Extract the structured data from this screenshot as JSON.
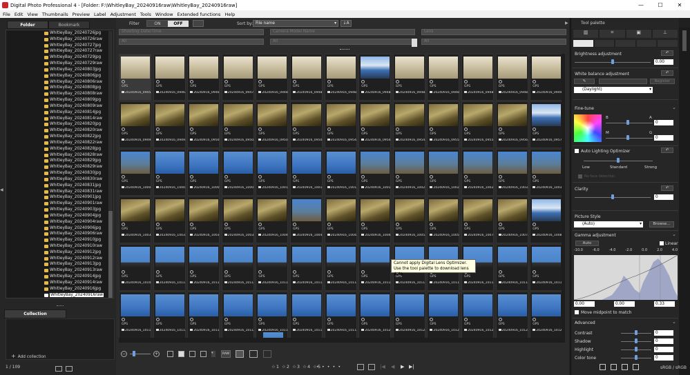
{
  "window": {
    "title": "Digital Photo Professional 4 - [Folder: F:\\WhitleyBay_20240916raw\\WhitleyBay_20240916raw]",
    "controls": [
      "—",
      "☐",
      "✕"
    ]
  },
  "menu": [
    "File",
    "Edit",
    "View",
    "Thumbnails",
    "Preview",
    "Label",
    "Adjustment",
    "Tools",
    "Window",
    "Extended functions",
    "Help"
  ],
  "left": {
    "tabs": [
      "Folder",
      "Bookmark"
    ],
    "folders": [
      "WhitleyBay_20240726jpg",
      "WhitleyBay_20240726raw",
      "WhitleyBay_20240727jpg",
      "WhitleyBay_20240727raw",
      "WhitleyBay_20240729jpg",
      "WhitleyBay_20240729raw",
      "WhitleyBay_20240803jpg",
      "WhitleyBay_20240806jpg",
      "WhitleyBay_20240806raw",
      "WhitleyBay_20240808jpg",
      "WhitleyBay_20240808raw",
      "WhitleyBay_20240809jpg",
      "WhitleyBay_20240809raw",
      "WhitleyBay_20240814jpg",
      "WhitleyBay_20240814raw",
      "WhitleyBay_20240820jpg",
      "WhitleyBay_20240820raw",
      "WhitleyBay_20240822jpg",
      "WhitleyBay_20240822raw",
      "WhitleyBay_20240828jpg",
      "WhitleyBay_20240828raw",
      "WhitleyBay_20240829jpg",
      "WhitleyBay_20240829raw",
      "WhitleyBay_20240830jpg",
      "WhitleyBay_20240830raw",
      "WhitleyBay_20240831jpg",
      "WhitleyBay_20240831raw",
      "WhitleyBay_20240901jpg",
      "WhitleyBay_20240901raw",
      "WhitleyBay_20240903jpg",
      "WhitleyBay_20240904jpg",
      "WhitleyBay_20240904raw",
      "WhitleyBay_20240906jpg",
      "WhitleyBay_20240906raw",
      "WhitleyBay_20240910jpg",
      "WhitleyBay_20240910raw",
      "WhitleyBay_20240912jpg",
      "WhitleyBay_20240912raw",
      "WhitleyBay_20240913jpg",
      "WhitleyBay_20240913raw",
      "WhitleyBay_20240914jpg",
      "WhitleyBay_20240914raw",
      "WhitleyBay_20240916jpg",
      "WhitleyBay_20240916raw"
    ],
    "selected_folder": "WhitleyBay_20240916raw",
    "collection_tab": "Collection",
    "add_collection": "Add collection",
    "count": "1 / 109"
  },
  "filter": {
    "label": "Filter",
    "on": "ON",
    "off": "OFF",
    "sortby_label": "Sort by:",
    "sortby_value": "File name",
    "sub1": "Shooting Date/Time",
    "sub2": "Camera Model Name",
    "sub3": "Lens",
    "all": "All"
  },
  "thumbs": {
    "gps": "GPS",
    "rows": [
      {
        "label": "20240916_0948...",
        "theme": [
          "sand",
          "sand",
          "sand",
          "sand",
          "sand",
          "sand",
          "sand",
          "sea",
          "sand",
          "sand",
          "sand",
          "sand",
          "sand"
        ]
      },
      {
        "label": "20240916_0949...",
        "theme": [
          "weed",
          "weed",
          "weed",
          "weed",
          "weed",
          "weed",
          "weed",
          "weed",
          "weed",
          "weed",
          "weed",
          "weed",
          "sea"
        ]
      },
      {
        "label": "20240916_1000...",
        "theme": [
          "rock",
          "blue",
          "blue",
          "blue",
          "blue",
          "blue",
          "blue",
          "rock",
          "rock",
          "rock",
          "rock",
          "rock",
          "rock"
        ]
      },
      {
        "label": "20240916_1003...",
        "theme": [
          "weed",
          "weed",
          "weed",
          "weed",
          "weed",
          "rock",
          "weed",
          "weed",
          "weed",
          "weed",
          "weed",
          "weed",
          "sea"
        ]
      },
      {
        "label": "20240916_1010...",
        "theme": [
          "shore",
          "shore",
          "shore",
          "shore",
          "shore",
          "shore",
          "shore",
          "shore",
          "shore",
          "shore",
          "shore",
          "shore",
          "shore"
        ]
      },
      {
        "label": "20240916_1011...",
        "theme": [
          "blue",
          "blue",
          "blue",
          "blue",
          "blue",
          "blue",
          "blue",
          "blue",
          "blue",
          "blue",
          "blue",
          "blue",
          "blue"
        ]
      }
    ],
    "labels": [
      [
        "20240916_0945...",
        "20240916_0946...",
        "20240916_0946...",
        "20240916_0947...",
        "20240916_0948...",
        "20240916_0948...",
        "20240916_0948...",
        "20240916_0948...",
        "20240916_0948...",
        "20240916_0948...",
        "20240916_0948...",
        "20240916_0948...",
        "20240916_0949..."
      ],
      [
        "20240916_0949...",
        "20240916_0949...",
        "20240916_0950...",
        "20240916_0950...",
        "20240916_0950...",
        "20240916_0950...",
        "20240916_0954...",
        "20240916_0954...",
        "20240916_0954...",
        "20240916_0955...",
        "20240916_0955...",
        "20240916_0956...",
        "20240916_0957..."
      ],
      [
        "20240916_1000...",
        "20240916_1000...",
        "20240916_1000...",
        "20240916_1000...",
        "20240916_1001...",
        "20240916_1001...",
        "20240916_1001...",
        "20240916_1001...",
        "20240916_1002...",
        "20240916_1002...",
        "20240916_1002...",
        "20240916_1003...",
        "20240916_1003..."
      ],
      [
        "20240916_1003...",
        "20240916_1003...",
        "20240916_1003...",
        "20240916_1003...",
        "20240916_1004...",
        "20240916_1004...",
        "20240916_1004...",
        "20240916_1004...",
        "20240916_1005...",
        "20240916_1005...",
        "20240916_1007...",
        "20240916_1007...",
        "20240916_1008..."
      ],
      [
        "20240916_1010...",
        "20240916_1011...",
        "20240916_1011...",
        "20240916_1011...",
        "20240916_1011...",
        "20240916_1011...",
        "20240916_1011...",
        "20240916_1011...",
        "20240916_1011...",
        "20240916_1011...",
        "20240916_1011...",
        "20240916_1011...",
        "20240916_1011..."
      ],
      [
        "20240916_1011...",
        "20240916_1011...",
        "20240916_1011...",
        "20240916_1011...",
        "20240916_1011...",
        "20240916_1011...",
        "20240916_1011...",
        "20240916_1012...",
        "20240916_1012...",
        "20240916_1012...",
        "20240916_1012...",
        "20240916_1012...",
        "20240916_1012..."
      ]
    ]
  },
  "tooltip": {
    "line1": "Cannot apply Digital Lens Optimizer.",
    "line2": "Use the tool palette to download lens data."
  },
  "toolbar_bottom": {
    "raw_label": "RAW",
    "stars": [
      "1",
      "2",
      "3",
      "4",
      "5"
    ]
  },
  "right": {
    "title": "Tool palette",
    "brightness": {
      "label": "Brightness adjustment",
      "value": "0.00"
    },
    "white_balance": {
      "label": "White balance adjustment",
      "register": "Register",
      "preset": "(Daylight)"
    },
    "finetune": {
      "label": "Fine-tune",
      "b": "B",
      "a": "A",
      "m": "M",
      "g": "G",
      "val1": "0",
      "val2": "0"
    },
    "alo": {
      "label": "Auto Lighting Optimizer",
      "low": "Low",
      "standard": "Standard",
      "strong": "Strong",
      "noface": "No face detection"
    },
    "clarity": {
      "label": "Clarity",
      "value": "0"
    },
    "picture_style": {
      "label": "Picture Style",
      "value": "(Auto)",
      "browse": "Browse..."
    },
    "gamma": {
      "label": "Gamma adjustment",
      "auto": "Auto",
      "linear": "Linear",
      "scale": [
        "-10.0",
        "-6.0",
        "-4.0",
        "-2.0",
        "0.0",
        "2.0",
        "4.0"
      ],
      "v1": "0.00",
      "v2": "0.00",
      "v3": "0.33",
      "midpoint": "Move midpoint to match"
    },
    "advanced": {
      "label": "Advanced",
      "contrast": "Contrast",
      "shadow": "Shadow",
      "highlight": "Highlight",
      "colortone": "Color tone",
      "val": "0"
    },
    "colorspace": "sRGB / sRGB"
  },
  "colors": {
    "accent": "#6f9fdc",
    "bg": "#2b2b2b",
    "panel": "#262626"
  }
}
